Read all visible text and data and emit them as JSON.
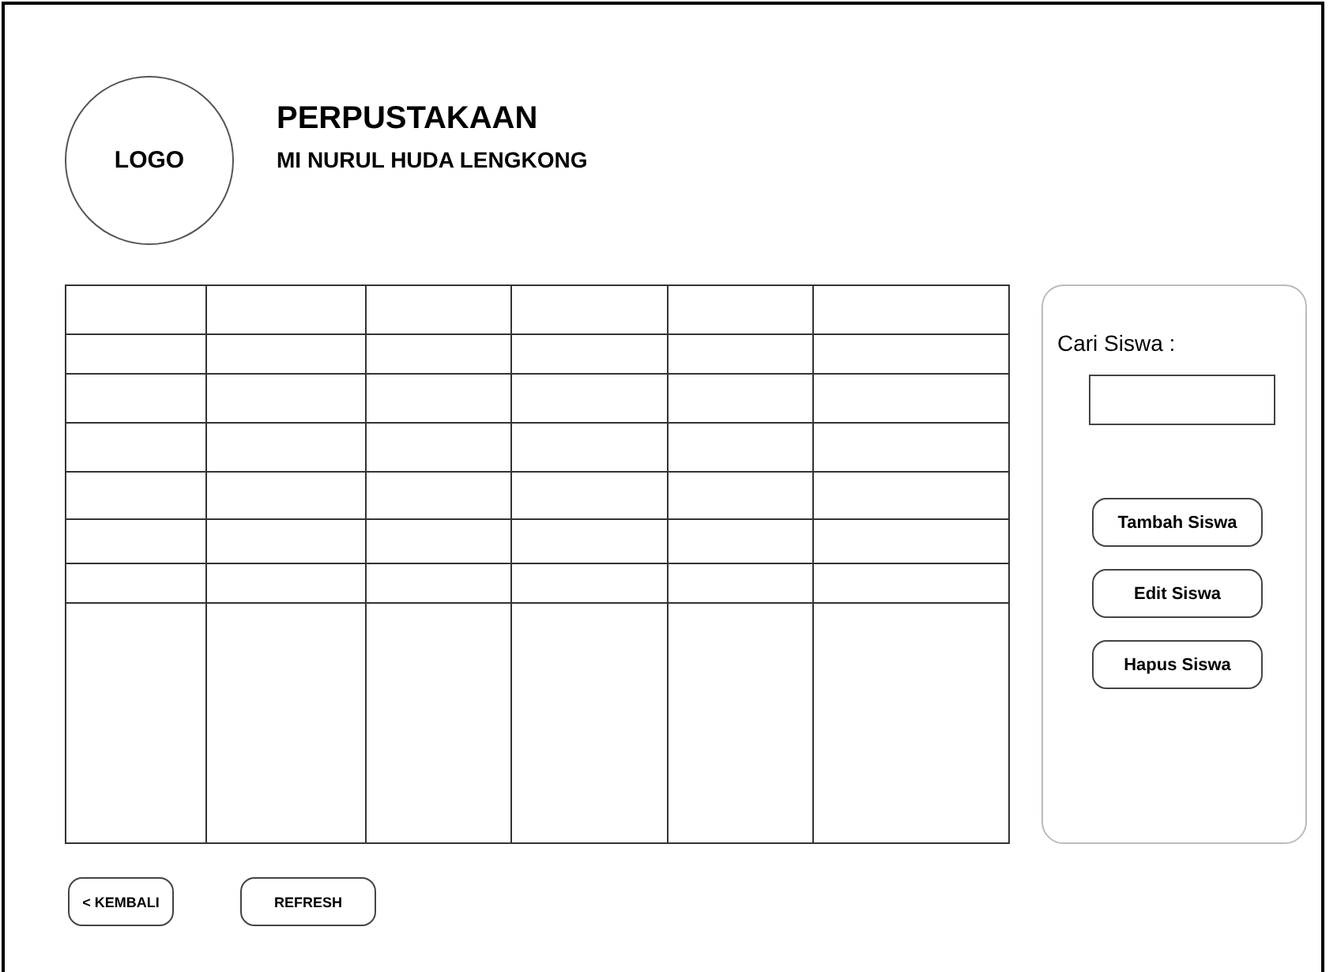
{
  "logo": {
    "label": "LOGO"
  },
  "header": {
    "title": "PERPUSTAKAAN",
    "subtitle": "MI NURUL HUDA LENGKONG"
  },
  "search": {
    "label": "Cari Siswa :"
  },
  "actions": [
    "Tambah Siswa",
    "Edit Siswa",
    "Hapus Siswa"
  ],
  "footer_buttons": [
    "< KEMBALI",
    "REFRESH"
  ]
}
